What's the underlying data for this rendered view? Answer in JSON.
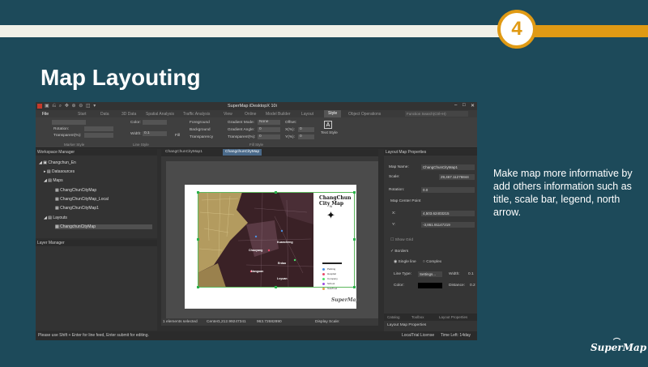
{
  "slide": {
    "step_number": "4",
    "title": "Map Layouting",
    "description": "Make map more informative by add others information such as title, scale bar, legend, north arrow.",
    "brand": "SuperMap",
    "colors": {
      "background": "#1d4a5a",
      "band": "#f1f1e8",
      "accent": "#e09a14"
    }
  },
  "app": {
    "title": "SuperMap iDesktopX 10i",
    "quick_access_icons": [
      "logo-icon",
      "save-icon",
      "undo-icon",
      "zoom-icon",
      "pan-icon"
    ],
    "ribbon_tabs": [
      "File",
      "Start",
      "Data",
      "3D Data",
      "Spatial Analysis",
      "Traffic Analysis",
      "View",
      "Online",
      "Model Builder",
      "Layout",
      "Style",
      "Object Operations"
    ],
    "active_tab": "Style",
    "search_placeholder": "Function Search(Ctrl+H)",
    "ribbon": {
      "rotation_label": "Rotation:",
      "rotation_value": "0.0",
      "transparent_label": "Transparent(%):",
      "transparent_value": "0",
      "marker_group": "Marker Style",
      "color_label": "Color:",
      "width_label": "Width:",
      "width_value": "0.1",
      "line_group": "Line Style",
      "fill_label": "Fill",
      "foreground_label": "Foreground",
      "background_label": "Background",
      "transparency_label": "Transparency",
      "gradient_mode_label": "Gradient Mode:",
      "gradient_mode_value": "None",
      "gradient_angle_label": "Gradient Angle:",
      "gradient_angle_value": "0",
      "transparent2_label": "Transparent(%):",
      "transparent2_value": "0",
      "offset_label": "Offset:",
      "xpct_label": "X(%):",
      "xpct_value": "0",
      "ypct_label": "Y(%):",
      "ypct_value": "0",
      "fill_group": "Fill Style",
      "text_style_label": "Text Style"
    },
    "workspace": {
      "header": "Workspace Manager",
      "items": [
        "Changchun_En",
        "Datasources",
        "Maps",
        "ChangChunCityMap",
        "ChangChunCityMap_Local",
        "ChangChunCityMap1",
        "Layouts",
        "ChangchunCityMap"
      ]
    },
    "layer_manager_header": "Layer Manager",
    "doc_tabs": [
      "ChangChunCityMap1",
      "ChangchunCityMap"
    ],
    "layout": {
      "map_title": "ChangChun City Map",
      "north_arrow": "N",
      "legend": [
        "Parking",
        "Hospital",
        "Company",
        "School",
        "Gas/Fuel"
      ],
      "page_brand": "SuperMap",
      "places": [
        "Chaoyang",
        "Kuancheng",
        "Erdao",
        "Nanguan",
        "Lvyuan"
      ]
    },
    "canvas_status": {
      "selected": "1 elements selected",
      "center_label": "Center:",
      "center_x": "1,212.99247341",
      "center_y": "963.72682890",
      "display_scale_label": "Display Scale:"
    },
    "properties": {
      "header": "Layout Map Properties",
      "map_name_label": "Map Name:",
      "map_name_value": "ChangChunCityMap1",
      "scale_label": "Scale:",
      "scale_value": "29,467.11276844",
      "rotation_label": "Rotation:",
      "rotation_value": "0.0",
      "center_point_label": "Map Center Point",
      "x_label": "X:",
      "x_value": "4,503.62403215",
      "y_label": "Y:",
      "y_value": "-3,861.91147219",
      "show_grid_label": "Show Grid",
      "borders_label": "Borders",
      "single_line_label": "Single line",
      "complex_label": "Complex",
      "line_type_label": "Line Type:",
      "line_type_button": "Settings...",
      "line_width_label": "Width:",
      "line_width_value": "0.1",
      "color_label": "Color:",
      "distance_label": "Distance:",
      "distance_value": "0.2",
      "bottom_tabs": [
        "Catalog",
        "Toolbox",
        "Layout Properties"
      ],
      "bottom_label": "Layout Map Properties"
    },
    "status": {
      "hint": "Please use Shift + Enter for line feed, Enter submit for editing.",
      "license": "LocalTrial License",
      "time_left": "Time Left: 14day"
    }
  }
}
